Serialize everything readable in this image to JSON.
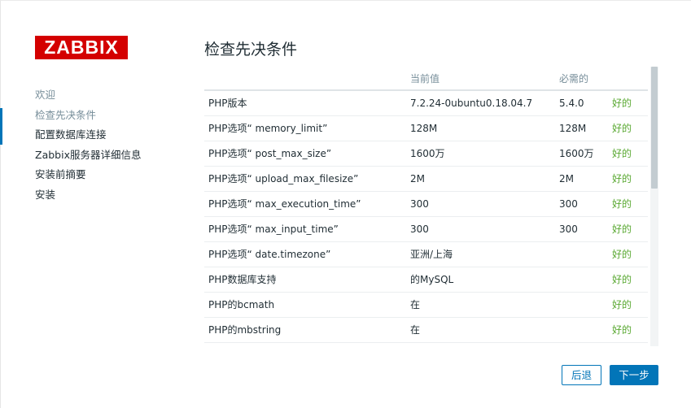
{
  "logo": {
    "text": "ZABBIX"
  },
  "steps": [
    {
      "label": "欢迎",
      "state": "done"
    },
    {
      "label": "检查先决条件",
      "state": "current"
    },
    {
      "label": "配置数据库连接",
      "state": "todo"
    },
    {
      "label": "Zabbix服务器详细信息",
      "state": "todo"
    },
    {
      "label": "安装前摘要",
      "state": "todo"
    },
    {
      "label": "安装",
      "state": "todo"
    }
  ],
  "page": {
    "title": "检查先决条件"
  },
  "table": {
    "headers": [
      "",
      "当前值",
      "必需的",
      ""
    ],
    "rows": [
      {
        "name": "PHP版本",
        "current": "7.2.24-0ubuntu0.18.04.7",
        "required": "5.4.0",
        "status": "好的"
      },
      {
        "name": "PHP选项“ memory_limit”",
        "current": "128M",
        "required": "128M",
        "status": "好的"
      },
      {
        "name": "PHP选项“ post_max_size”",
        "current": "1600万",
        "required": "1600万",
        "status": "好的"
      },
      {
        "name": "PHP选项“ upload_max_filesize”",
        "current": "2M",
        "required": "2M",
        "status": "好的"
      },
      {
        "name": "PHP选项“ max_execution_time”",
        "current": "300",
        "required": "300",
        "status": "好的"
      },
      {
        "name": "PHP选项“ max_input_time”",
        "current": "300",
        "required": "300",
        "status": "好的"
      },
      {
        "name": "PHP选项“ date.timezone”",
        "current": "亚洲/上海",
        "required": "",
        "status": "好的"
      },
      {
        "name": "PHP数据库支持",
        "current": "的MySQL",
        "required": "",
        "status": "好的"
      },
      {
        "name": "PHP的bcmath",
        "current": "在",
        "required": "",
        "status": "好的"
      },
      {
        "name": "PHP的mbstring",
        "current": "在",
        "required": "",
        "status": "好的"
      }
    ]
  },
  "buttons": {
    "back": "后退",
    "next": "下一步"
  },
  "colors": {
    "accent": "#0275b8",
    "ok": "#59a831",
    "logo": "#d40000"
  }
}
